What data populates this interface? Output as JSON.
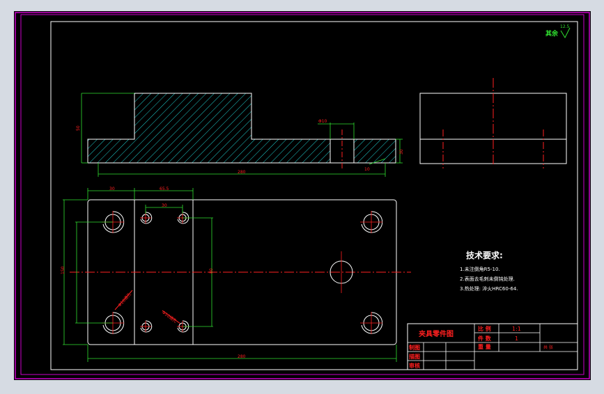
{
  "roughness": {
    "symbol_prefix": "其余",
    "value": "12.5"
  },
  "tech_requirements": {
    "title": "技术要求:",
    "items": [
      "1.未注倒角R5-10.",
      "2.表面去毛刺未倒钝处理.",
      "3.热处理: 淬火HRC60-64."
    ]
  },
  "title_block": {
    "part_name": "夹具零件图",
    "scale_label": "比 例",
    "scale_value": "1:1",
    "qty_label": "件 数",
    "qty_value": "1",
    "weight_label": "重 量",
    "sheet_label": "共 张",
    "rows": [
      "制图",
      "描图",
      "审核"
    ]
  },
  "dimensions": {
    "front_height": "50",
    "front_length": "280",
    "front_thickness": "30",
    "hole_dia": "Φ10",
    "front_small": "10",
    "top_left": "30",
    "top_mid": "65.5",
    "top_inner": "30",
    "left_overall": "150",
    "center_height": "80",
    "bottom_overall": "280",
    "angled_1": "Φ10通孔",
    "angled_2": "Φ10通孔"
  },
  "colors": {
    "background": "#000000",
    "frame": "#cc00cc",
    "outline": "#ffffff",
    "centerline": "#ff2020",
    "hatch": "#20d0d0",
    "dimension": "#30e030",
    "text": "#ffffff",
    "accent_text": "#ff2020"
  }
}
